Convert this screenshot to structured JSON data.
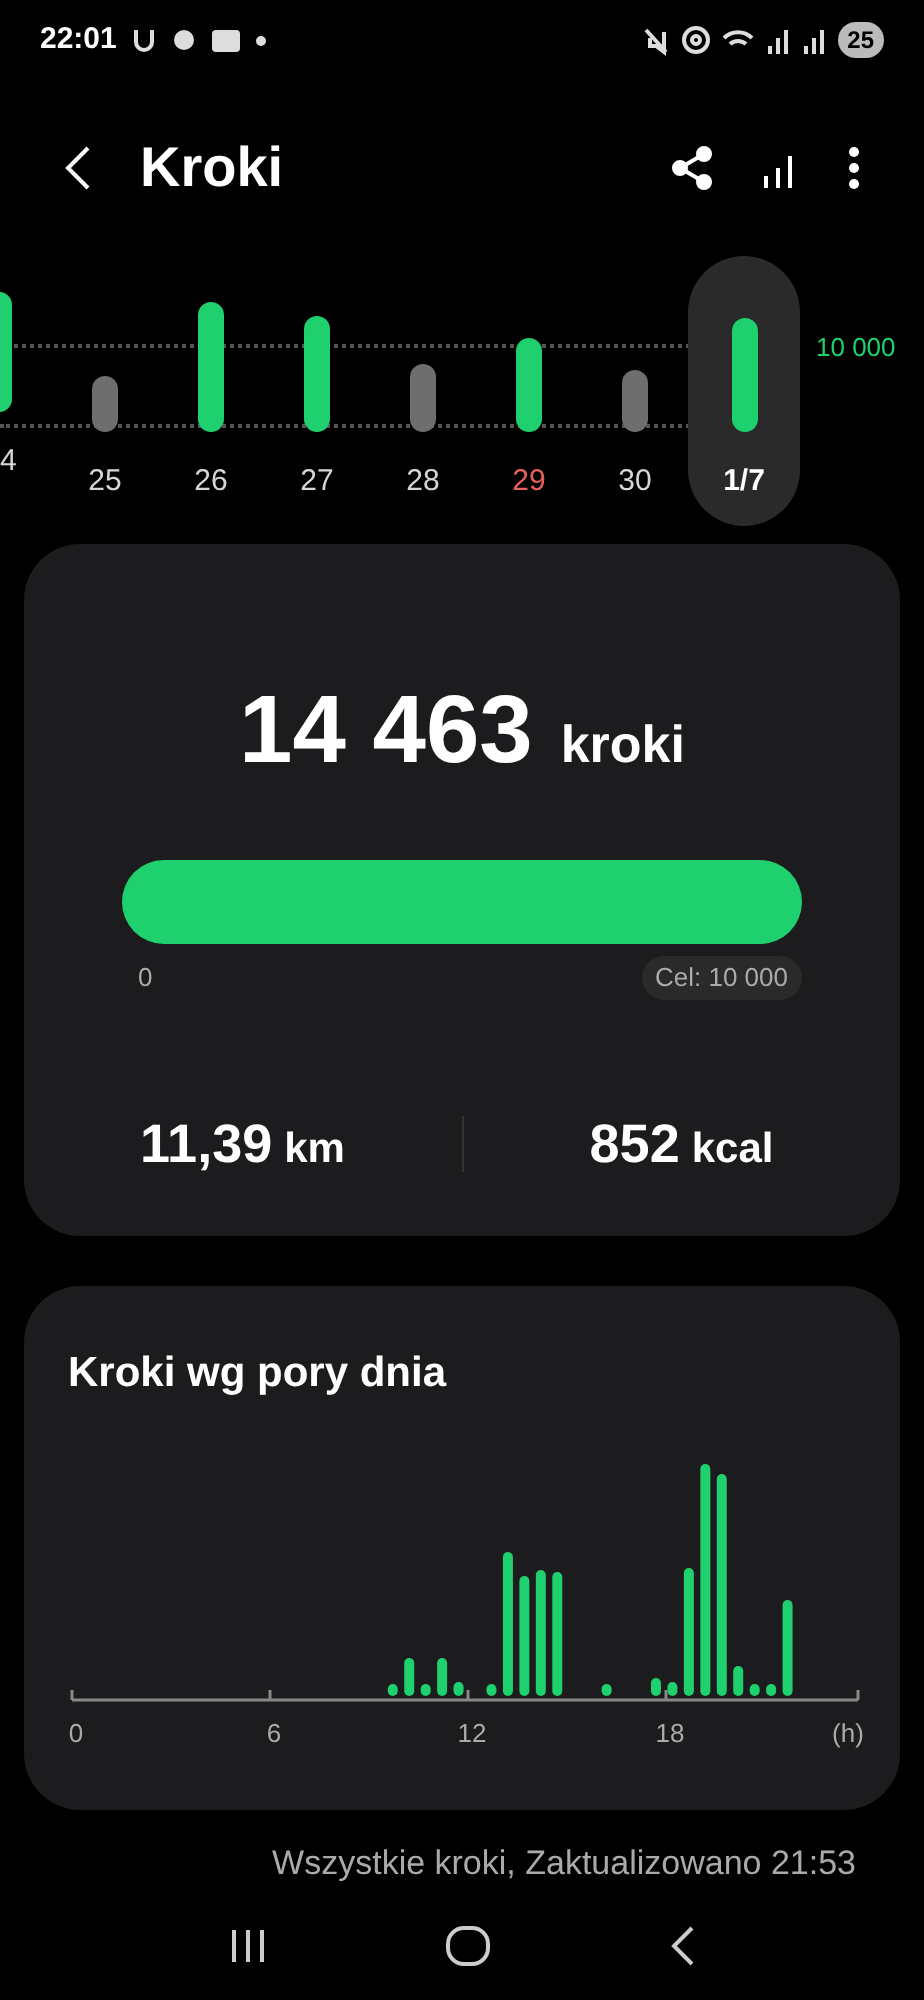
{
  "status_bar": {
    "time": "22:01",
    "battery": "25"
  },
  "header": {
    "title": "Kroki"
  },
  "week": {
    "goal_label": "10 000",
    "days": [
      {
        "label": "4",
        "goal_met": true,
        "selected": false,
        "color": "#d6d6d6"
      },
      {
        "label": "25",
        "goal_met": false,
        "selected": false,
        "color": "#d6d6d6"
      },
      {
        "label": "26",
        "goal_met": true,
        "selected": false,
        "color": "#d6d6d6"
      },
      {
        "label": "27",
        "goal_met": true,
        "selected": false,
        "color": "#d6d6d6"
      },
      {
        "label": "28",
        "goal_met": false,
        "selected": false,
        "color": "#d6d6d6"
      },
      {
        "label": "29",
        "goal_met": true,
        "selected": false,
        "color": "#e8605c"
      },
      {
        "label": "30",
        "goal_met": false,
        "selected": false,
        "color": "#d6d6d6"
      },
      {
        "label": "1/7",
        "goal_met": true,
        "selected": true,
        "color": "#ffffff"
      }
    ]
  },
  "summary": {
    "steps": "14 463",
    "unit": "kroki",
    "progress": {
      "level": 1,
      "min_label": "0",
      "goal_label": "Cel: 10 000"
    },
    "stats": [
      {
        "value": "11,39",
        "unit": "km"
      },
      {
        "value": "852",
        "unit": "kcal"
      }
    ]
  },
  "time_of_day": {
    "title": "Kroki wg pory dnia",
    "axis_labels": [
      "0",
      "6",
      "12",
      "18",
      "(h)"
    ]
  },
  "footer": "Wszystkie kroki, Zaktualizowano 21:53"
}
